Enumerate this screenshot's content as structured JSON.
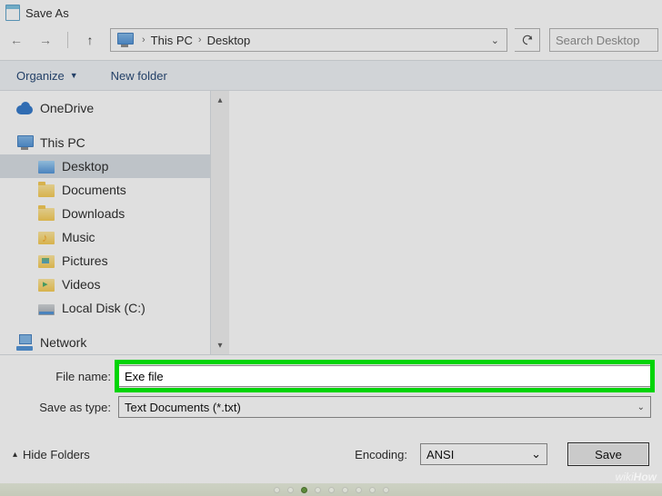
{
  "title": "Save As",
  "nav": {
    "segments": [
      "This PC",
      "Desktop"
    ],
    "search_placeholder": "Search Desktop"
  },
  "toolbar": {
    "organize": "Organize",
    "new_folder": "New folder"
  },
  "tree": {
    "onedrive": "OneDrive",
    "this_pc": "This PC",
    "desktop": "Desktop",
    "documents": "Documents",
    "downloads": "Downloads",
    "music": "Music",
    "pictures": "Pictures",
    "videos": "Videos",
    "local_disk": "Local Disk (C:)",
    "network": "Network"
  },
  "form": {
    "file_name_label": "File name:",
    "file_name_value": "Exe file",
    "save_type_label": "Save as type:",
    "save_type_value": "Text Documents (*.txt)"
  },
  "bottom": {
    "hide_folders": "Hide Folders",
    "encoding_label": "Encoding:",
    "encoding_value": "ANSI",
    "save": "Save"
  },
  "watermark": "wikiHow"
}
